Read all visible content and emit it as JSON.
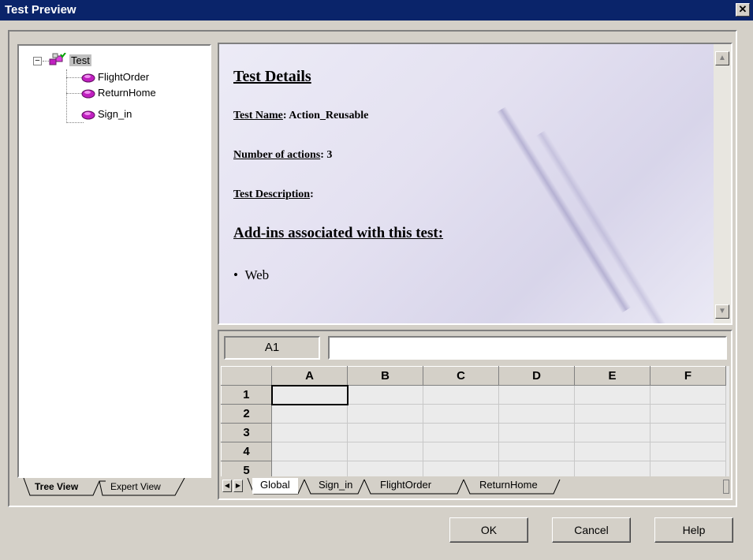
{
  "window": {
    "title": "Test Preview",
    "close_glyph": "✕"
  },
  "tree": {
    "expander_glyph": "−",
    "root": {
      "label": "Test",
      "icon": "test-icon"
    },
    "items": [
      {
        "label": "FlightOrder",
        "icon": "action-icon"
      },
      {
        "label": "ReturnHome",
        "icon": "action-icon"
      },
      {
        "label": "Sign_in",
        "icon": "action-icon"
      }
    ],
    "tabs": [
      {
        "label": "Tree View",
        "active": true
      },
      {
        "label": "Expert View",
        "active": false
      }
    ]
  },
  "preview": {
    "heading": "Test Details",
    "test_name_label": "Test Name",
    "test_name_value": ": Action_Reusable",
    "num_actions_label": "Number of actions",
    "num_actions_value": ": 3",
    "description_label": "Test Description",
    "description_value": ":",
    "addins_heading": "Add-ins associated with this test:",
    "addins": [
      "Web"
    ],
    "bullet": "•"
  },
  "datatable": {
    "cell_reference": "A1",
    "formula_value": "",
    "columns": [
      "A",
      "B",
      "C",
      "D",
      "E",
      "F"
    ],
    "rows": [
      "1",
      "2",
      "3",
      "4",
      "5"
    ],
    "sheet_tabs": [
      "Global",
      "Sign_in",
      "FlightOrder",
      "ReturnHome"
    ],
    "active_sheet": "Global",
    "nav_prev": "◀",
    "nav_next": "▶"
  },
  "buttons": {
    "ok": "OK",
    "cancel": "Cancel",
    "help": "Help"
  },
  "scroll": {
    "up": "▲",
    "down": "▼"
  },
  "colors": {
    "titlebar": "#0a246a",
    "dialog": "#d4d0c8",
    "action_icon": "#c020c0"
  }
}
